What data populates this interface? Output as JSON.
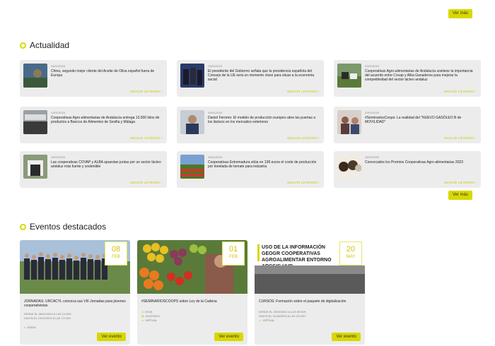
{
  "top_more_label": "Ver más",
  "news_section": {
    "title": "Actualidad",
    "more_label": "Ver más",
    "read_more": "SEGUIR LEYENDO  ›",
    "items": [
      {
        "date": "24/01/2023",
        "title": "China, segundo mejor cliente del Aceite de Oliva español fuera de Europa"
      },
      {
        "date": "24/01/2023",
        "title": "El presidente del Gobierno señala que la presidencia española del Consejo de la UE será un momento clave para situar a la economía social"
      },
      {
        "date": "23/01/2023",
        "title": "Cooperativas Agro-alimentarias de Andalucía sostiene la importancia del acuerdo entre Covap y Alba Ganaderos para mejorar la competitividad del sector lácteo andaluz"
      },
      {
        "date": "23/01/2023",
        "title": "Cooperativas Agro-alimentarias de Andalucía entrega 13.500 kilos de productos a Bancos de Alimentos de Sevilla y Málaga"
      },
      {
        "date": "20/01/2023",
        "title": "Daniel Ferreiro: El modelo de producción europeo abre las puertas a los lácteos en los mercados exteriores"
      },
      {
        "date": "20/01/2023",
        "title": "#SeminariosCoops: La realidad del \"NUEVO GASÓLEO B de MOVILIDAD\""
      },
      {
        "date": "18/01/2023",
        "title": "Las cooperativas COVAP y ALBA apuestan juntas por un sector lácteo andaluz más fuerte y sostenible"
      },
      {
        "date": "18/01/2023",
        "title": "Cooperativas Extremadura sitúa en 138 euros el coste de producción por tonelada de tomate para industria"
      },
      {
        "date": "16/01/2023",
        "title": "Convocados los Premios Cooperativas Agro-alimentarias 2023"
      }
    ]
  },
  "events_section": {
    "title": "Eventos destacados",
    "button_label": "Ver evento",
    "items": [
      {
        "day": "08",
        "month": "FEB",
        "title": "JORNADAS: URCACYL convoca sus VIII Jornadas para jóvenes cooperativistas",
        "line1": "DESDE EL 08/02/2023 A LAS 12:30H",
        "line2": "HASTA EL 10/02/2023 A LAS 17:00H",
        "line3": "SORIA"
      },
      {
        "day": "01",
        "month": "FEB",
        "title": "#SEMINARIOSCOOPS sobre Ley de la Cadena",
        "line1": "09:45",
        "line2": "01/02/2023",
        "line3": "VIRTUAL"
      },
      {
        "day": "20",
        "month": "MAY",
        "title": "CURSOS: Formación sobre el paquete de digitalización",
        "line1": "DESDE EL 20/09/2022 A LAS 09:00H",
        "line2": "HASTA EL 31/08/2023 A LAS 20:00H",
        "line3": "VIRTUAL",
        "image_text": "USO DE LA INFORMACIÓN GEOGR COOPERATIVAS AGROALIMENTAR ENTORNO ARCGIS HUB"
      }
    ]
  },
  "colors": {
    "accent": "#d8d800",
    "card_bg": "#ececec"
  }
}
